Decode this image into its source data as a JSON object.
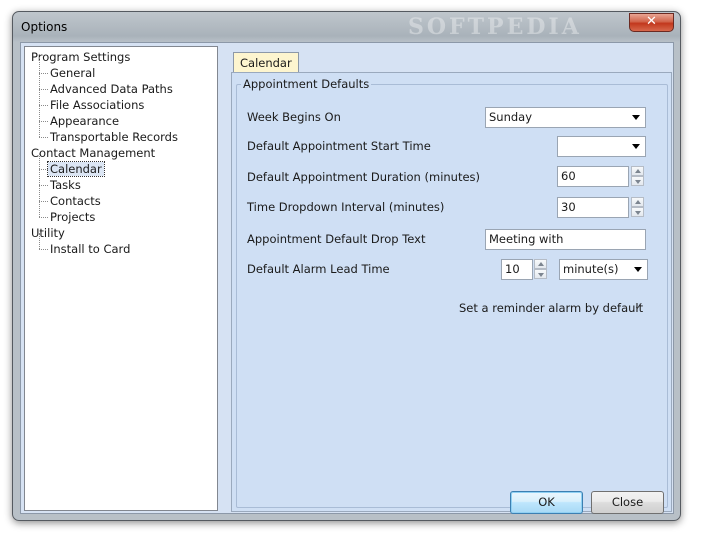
{
  "window": {
    "title": "Options",
    "watermark": "SOFTPEDIA",
    "close_glyph": "✕"
  },
  "tree": {
    "items": [
      {
        "label": "Program Settings",
        "level": 0
      },
      {
        "label": "General",
        "level": 1
      },
      {
        "label": "Advanced Data Paths",
        "level": 1
      },
      {
        "label": "File Associations",
        "level": 1
      },
      {
        "label": "Appearance",
        "level": 1
      },
      {
        "label": "Transportable Records",
        "level": 1
      },
      {
        "label": "Contact Management",
        "level": 0
      },
      {
        "label": "Calendar",
        "level": 1,
        "selected": true
      },
      {
        "label": "Tasks",
        "level": 1
      },
      {
        "label": "Contacts",
        "level": 1
      },
      {
        "label": "Projects",
        "level": 1
      },
      {
        "label": "Utility",
        "level": 0
      },
      {
        "label": "Install to Card",
        "level": 1
      }
    ]
  },
  "tab": {
    "label": "Calendar"
  },
  "group": {
    "title": "Appointment Defaults",
    "week_begins_on": {
      "label": "Week Begins On",
      "value": "Sunday"
    },
    "start_time": {
      "label": "Default Appointment Start Time",
      "value": ""
    },
    "duration": {
      "label": "Default Appointment Duration (minutes)",
      "value": "60"
    },
    "interval": {
      "label": "Time Dropdown Interval (minutes)",
      "value": "30"
    },
    "drop_text": {
      "label": "Appointment Default Drop Text",
      "value": "Meeting with"
    },
    "alarm_lead": {
      "label": "Default Alarm Lead Time",
      "value": "10",
      "unit": "minute(s)"
    },
    "reminder": {
      "label": "Set a reminder alarm by default",
      "checked": true,
      "glyph": "✓"
    }
  },
  "buttons": {
    "ok": "OK",
    "close": "Close"
  }
}
